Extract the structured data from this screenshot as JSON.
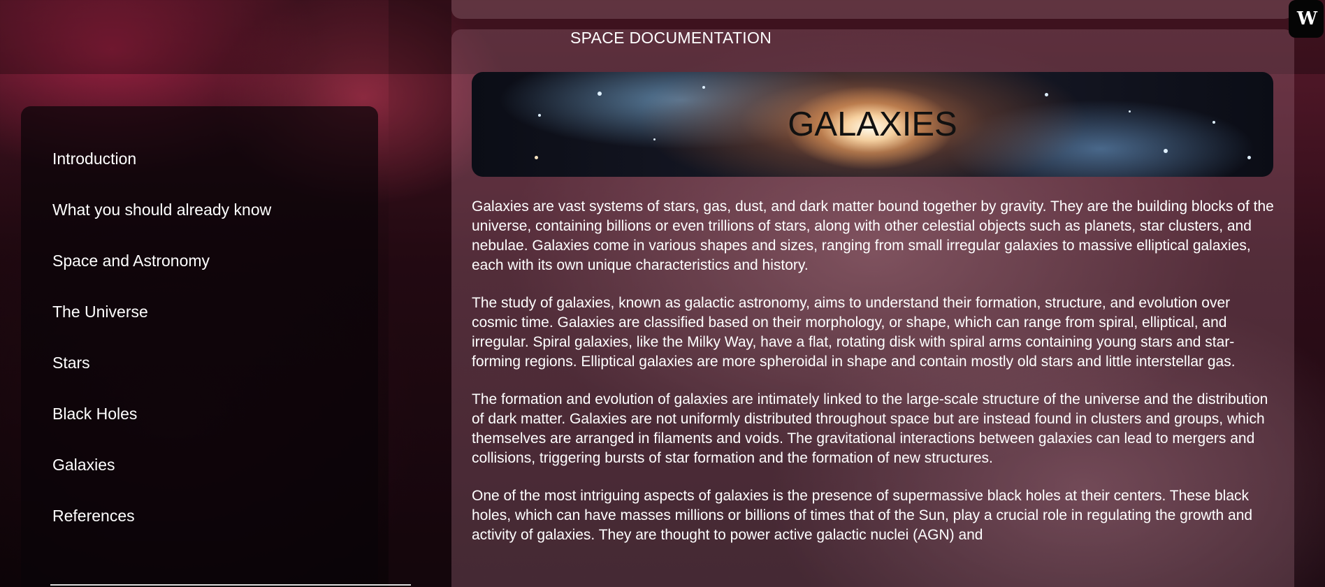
{
  "header": {
    "doc_title": "SPACE DOCUMENTATION"
  },
  "sidebar": {
    "items": [
      {
        "label": "Introduction"
      },
      {
        "label": "What you should already know"
      },
      {
        "label": "Space and Astronomy"
      },
      {
        "label": "The Universe"
      },
      {
        "label": "Stars"
      },
      {
        "label": "Black Holes"
      },
      {
        "label": "Galaxies"
      },
      {
        "label": "References"
      }
    ]
  },
  "main": {
    "hero_title": "GALAXIES",
    "paragraphs": [
      "Galaxies are vast systems of stars, gas, dust, and dark matter bound together by gravity. They are the building blocks of the universe, containing billions or even trillions of stars, along with other celestial objects such as planets, star clusters, and nebulae. Galaxies come in various shapes and sizes, ranging from small irregular galaxies to massive elliptical galaxies, each with its own unique characteristics and history.",
      "The study of galaxies, known as galactic astronomy, aims to understand their formation, structure, and evolution over cosmic time. Galaxies are classified based on their morphology, or shape, which can range from spiral, elliptical, and irregular. Spiral galaxies, like the Milky Way, have a flat, rotating disk with spiral arms containing young stars and star-forming regions. Elliptical galaxies are more spheroidal in shape and contain mostly old stars and little interstellar gas.",
      "The formation and evolution of galaxies are intimately linked to the large-scale structure of the universe and the distribution of dark matter. Galaxies are not uniformly distributed throughout space but are instead found in clusters and groups, which themselves are arranged in filaments and voids. The gravitational interactions between galaxies can lead to mergers and collisions, triggering bursts of star formation and the formation of new structures.",
      "One of the most intriguing aspects of galaxies is the presence of supermassive black holes at their centers. These black holes, which can have masses millions or billions of times that of the Sun, play a crucial role in regulating the growth and activity of galaxies. They are thought to power active galactic nuclei (AGN) and"
    ]
  },
  "badge": {
    "label": "W"
  }
}
